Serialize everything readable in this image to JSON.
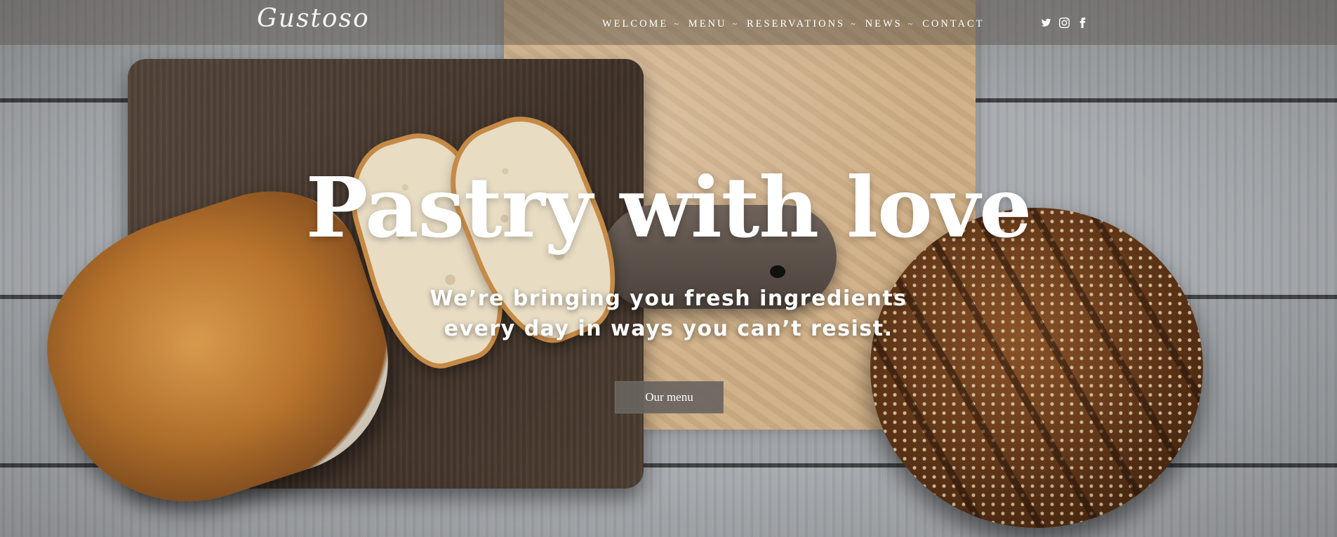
{
  "brand": {
    "logo_text": "Gustoso"
  },
  "nav": {
    "items": [
      {
        "label": "WELCOME",
        "caret": "~"
      },
      {
        "label": "MENU",
        "caret": "~"
      },
      {
        "label": "RESERVATIONS",
        "caret": "~"
      },
      {
        "label": "NEWS",
        "caret": "~"
      },
      {
        "label": "CONTACT",
        "caret": ""
      }
    ]
  },
  "social": [
    {
      "icon": "twitter-icon"
    },
    {
      "icon": "instagram-icon"
    },
    {
      "icon": "facebook-icon"
    }
  ],
  "hero": {
    "title": "Pastry with love",
    "subtitle_line1": "We’re bringing you fresh ingredients",
    "subtitle_line2": "every day in ways you can’t resist.",
    "cta_label": "Our menu"
  },
  "colors": {
    "text": "#ffffff",
    "header_overlay": "#5a524a",
    "button_bg": "#69645f"
  }
}
